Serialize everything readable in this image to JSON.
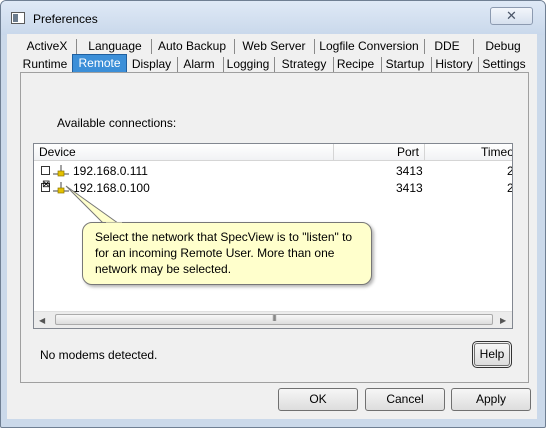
{
  "window": {
    "title": "Preferences",
    "close_glyph": "✕"
  },
  "tabs": {
    "row1": [
      "ActiveX",
      "Language",
      "Auto Backup",
      "Web Server",
      "Logfile Conversion",
      "DDE",
      "Debug"
    ],
    "row2": [
      "Runtime",
      "Remote",
      "Display",
      "Alarm",
      "Logging",
      "Strategy",
      "Recipe",
      "Startup",
      "History",
      "Settings"
    ],
    "active": "Remote"
  },
  "panel": {
    "connections_label": "Available connections:",
    "columns": [
      "Device",
      "Port",
      "Timeout"
    ],
    "rows": [
      {
        "checked": false,
        "device": "192.168.0.111",
        "port": "3413",
        "timeout": "2"
      },
      {
        "checked": true,
        "device": "192.168.0.100",
        "port": "3413",
        "timeout": "2"
      }
    ],
    "scroll_grip": "III",
    "modem_status": "No modems detected.",
    "help_label": "Help"
  },
  "tooltip": {
    "text": "Select the network that SpecView is to \"listen\" to for an incoming Remote User. More than one network may be selected."
  },
  "buttons": {
    "ok": "OK",
    "cancel": "Cancel",
    "apply": "Apply"
  },
  "icons": {
    "checkbox_checked": "⊠",
    "network": "network-connection-icon"
  },
  "colors": {
    "active_tab": "#3c8fd8",
    "tooltip_bg": "#ffffcc"
  }
}
